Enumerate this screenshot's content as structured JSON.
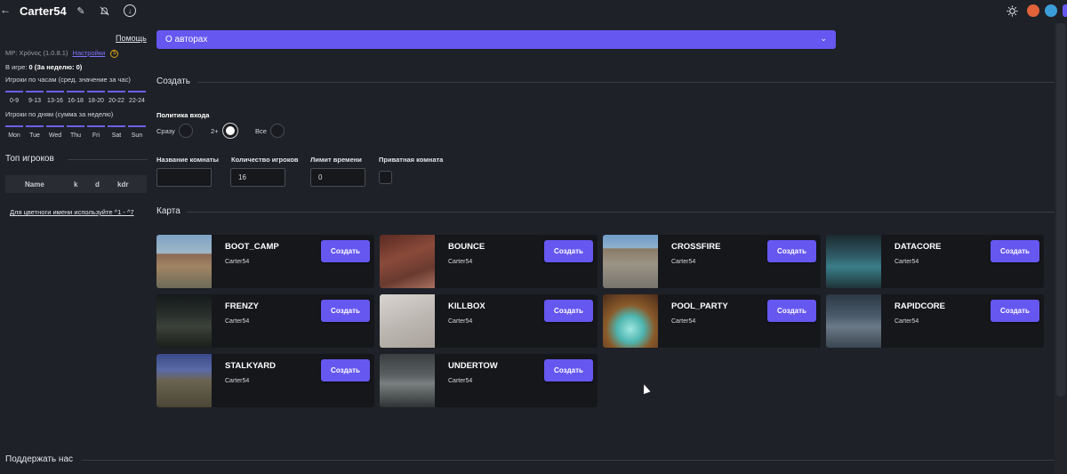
{
  "header": {
    "back_icon": "arrow-left-icon",
    "title": "Carter54",
    "icons": [
      "pencil-icon",
      "bell-off-icon",
      "download-icon",
      "sun-icon"
    ]
  },
  "sidebar": {
    "help": "Помощь",
    "mp_prefix": "MP:",
    "mp_version": "Xρόνος (1.0.8.1)",
    "settings": "Настройки",
    "coin": "$",
    "ingame_label": "В игре:",
    "ingame_value": "0 (За неделю: 0)",
    "hourly_label": "Игроки по часам (сред. значение за час)",
    "hour_ticks": [
      "0-9",
      "9-13",
      "13-16",
      "16-18",
      "18-20",
      "20-22",
      "22-24"
    ],
    "daily_label": "Игроки по дням (сумма за неделю)",
    "day_ticks": [
      "Mon",
      "Tue",
      "Wed",
      "Thu",
      "Fri",
      "Sat",
      "Sun"
    ],
    "top_players_title": "Топ игроков",
    "table_headers": [
      "Name",
      "k",
      "d",
      "kdr"
    ],
    "color_hint": "Для цветноги имени используйте ^1 - ^7"
  },
  "main": {
    "about_dropdown": "О авторах",
    "create_title": "Создать",
    "policy_title": "Политика входа",
    "policy_options": [
      "Сразу",
      "2+",
      "Все"
    ],
    "fields": {
      "room_name_label": "Название комнаты",
      "room_name_value": "",
      "players_label": "Количество игроков",
      "players_value": "16",
      "time_limit_label": "Лимит времени",
      "time_limit_value": "0",
      "private_label": "Приватная комната"
    },
    "map_title": "Карта",
    "create_button": "Создать",
    "maps": [
      {
        "name": "BOOT_CAMP",
        "author": "Carter54"
      },
      {
        "name": "BOUNCE",
        "author": "Carter54"
      },
      {
        "name": "CROSSFIRE",
        "author": "Carter54"
      },
      {
        "name": "DATACORE",
        "author": "Carter54"
      },
      {
        "name": "FRENZY",
        "author": "Carter54"
      },
      {
        "name": "KILLBOX",
        "author": "Carter54"
      },
      {
        "name": "POOL_PARTY",
        "author": "Carter54"
      },
      {
        "name": "RAPIDCORE",
        "author": "Carter54"
      },
      {
        "name": "STALKYARD",
        "author": "Carter54"
      },
      {
        "name": "UNDERTOW",
        "author": "Carter54"
      }
    ]
  },
  "footer": {
    "support": "Поддержать нас"
  },
  "colors": {
    "accent": "#6657f0",
    "background": "#1f2128",
    "card": "#16171b"
  }
}
